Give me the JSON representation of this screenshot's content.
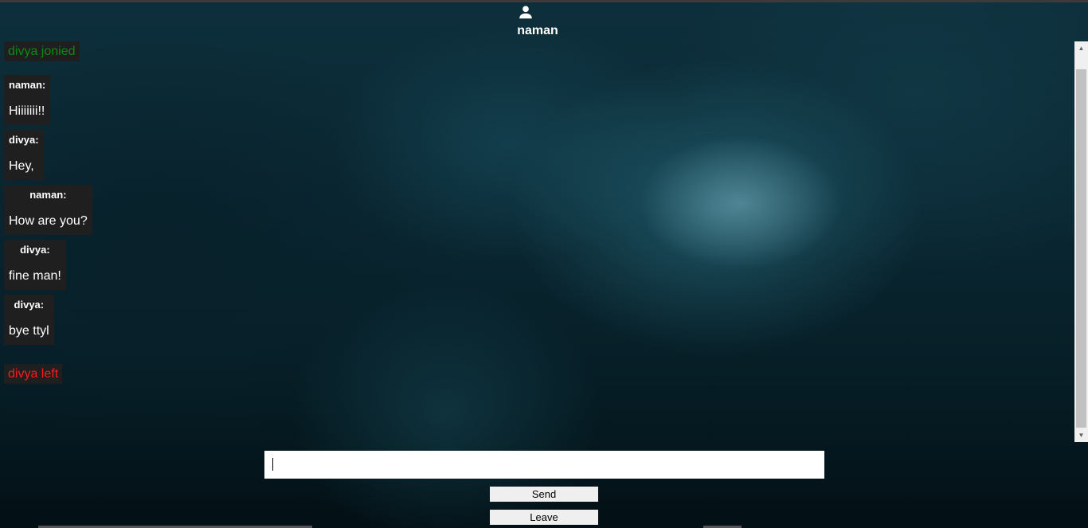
{
  "header": {
    "user_icon": "person-icon",
    "username": "naman"
  },
  "chat": {
    "join_notice": "divya jonied",
    "messages": [
      {
        "sender": "naman:",
        "text": "Hiiiiiii!!"
      },
      {
        "sender": "divya:",
        "text": "Hey,"
      },
      {
        "sender": "naman:",
        "text": "How are you?"
      },
      {
        "sender": "divya:",
        "text": "fine man!"
      },
      {
        "sender": "divya:",
        "text": "bye ttyl"
      }
    ],
    "leave_notice": "divya left"
  },
  "composer": {
    "input_value": "",
    "send_label": "Send",
    "leave_label": "Leave"
  },
  "colors": {
    "join_notice": "#0a8a16",
    "leave_notice": "#ff1a1a",
    "message_bubble": "#1f1f1f"
  }
}
